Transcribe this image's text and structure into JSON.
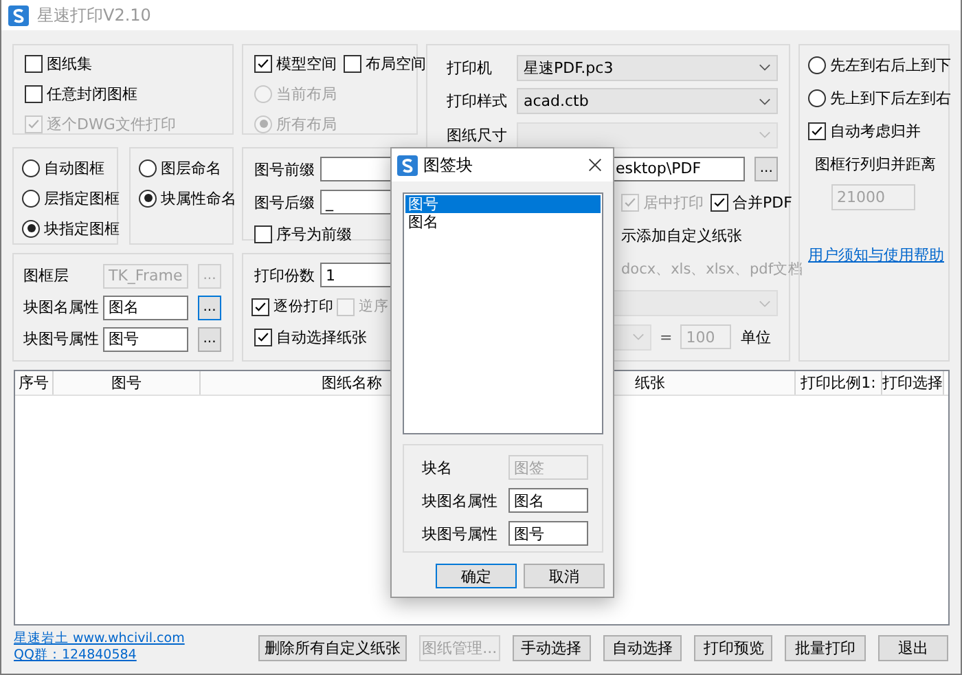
{
  "window": {
    "title": "星速打印V2.10"
  },
  "sheet_options": [
    {
      "label": "图纸集",
      "checked": false,
      "disabled": false
    },
    {
      "label": "任意封闭图框",
      "checked": false,
      "disabled": false
    },
    {
      "label": "逐个DWG文件打印",
      "checked": true,
      "disabled": true
    }
  ],
  "space": {
    "checks": [
      {
        "label": "模型空间",
        "checked": true
      },
      {
        "label": "布局空间",
        "checked": false
      }
    ],
    "layouts": [
      {
        "label": "当前布局",
        "selected": false,
        "disabled": true
      },
      {
        "label": "所有布局",
        "selected": true,
        "disabled": true
      }
    ]
  },
  "frame_modes": [
    {
      "label": "自动图框",
      "selected": false
    },
    {
      "label": "层指定图框",
      "selected": false
    },
    {
      "label": "块指定图框",
      "selected": true
    }
  ],
  "naming_modes": [
    {
      "label": "图层命名",
      "selected": false
    },
    {
      "label": "块属性命名",
      "selected": true
    }
  ],
  "numbering": {
    "prefix_label": "图号前缀",
    "suffix_label": "图号后缀",
    "suffix_value": "_",
    "serial_prefix": {
      "label": "序号为前缀",
      "checked": false
    }
  },
  "frame_attrs": [
    {
      "label": "图框层",
      "value": "TK_Frame",
      "disabled": true,
      "focused": false,
      "button": "..."
    },
    {
      "label": "块图名属性",
      "value": "图名",
      "disabled": false,
      "focused": true,
      "button": "..."
    },
    {
      "label": "块图号属性",
      "value": "图号",
      "disabled": false,
      "focused": false,
      "button": "..."
    }
  ],
  "copies": {
    "label": "打印份数",
    "value": "1",
    "options": [
      {
        "label": "逐份打印",
        "checked": true,
        "disabled": false
      },
      {
        "label": "逆序",
        "checked": false,
        "disabled": true
      }
    ],
    "auto_paper": {
      "label": "自动选择纸张",
      "checked": true
    }
  },
  "printer": {
    "rows": [
      {
        "label": "打印机",
        "value": "星速PDF.pc3",
        "disabled": false
      },
      {
        "label": "打印样式",
        "value": "acad.ctb",
        "disabled": false
      },
      {
        "label": "图纸尺寸",
        "disabled": true
      }
    ],
    "path": "esktop\\PDF",
    "path_button": "...",
    "options": [
      {
        "label": "居中打印",
        "checked": true,
        "disabled": true
      },
      {
        "label": "合并PDF",
        "checked": true,
        "disabled": false
      }
    ],
    "custom_paper_note": "示添加自定义纸张",
    "doc_types": "docx、xls、xlsx、pdf文档",
    "scale_equals": "=",
    "scale_value": "100",
    "unit": "单位"
  },
  "order": {
    "options": [
      {
        "label": "先左到右后上到下",
        "selected": false
      },
      {
        "label": "先上到下后左到右",
        "selected": false
      }
    ],
    "merge": {
      "label": "自动考虑归并",
      "checked": true
    },
    "distance_label": "图框行列归并距离",
    "distance_value": "21000",
    "help_link": "用户须知与使用帮助"
  },
  "table": {
    "columns": [
      "序号",
      "图号",
      "图纸名称",
      "纸张",
      "打印比例1:",
      "打印选择"
    ]
  },
  "footer": {
    "links": [
      "星速岩土 www.whcivil.com",
      "QQ群：124840584"
    ],
    "buttons": [
      {
        "label": "删除所有自定义纸张",
        "disabled": false
      },
      {
        "label": "图纸管理...",
        "disabled": true
      },
      {
        "label": "手动选择",
        "disabled": false
      },
      {
        "label": "自动选择",
        "disabled": false
      },
      {
        "label": "打印预览",
        "disabled": false
      },
      {
        "label": "批量打印",
        "disabled": false
      },
      {
        "label": "退出",
        "disabled": false
      }
    ]
  },
  "dialog": {
    "title": "图签块",
    "items": [
      {
        "label": "图号",
        "selected": true
      },
      {
        "label": "图名",
        "selected": false
      }
    ],
    "fields": [
      {
        "label": "块名",
        "value": "图签",
        "disabled": true
      },
      {
        "label": "块图名属性",
        "value": "图名",
        "disabled": false
      },
      {
        "label": "块图号属性",
        "value": "图号",
        "disabled": false
      }
    ],
    "buttons": [
      {
        "label": "确定",
        "default": true
      },
      {
        "label": "取消",
        "default": false
      }
    ]
  }
}
